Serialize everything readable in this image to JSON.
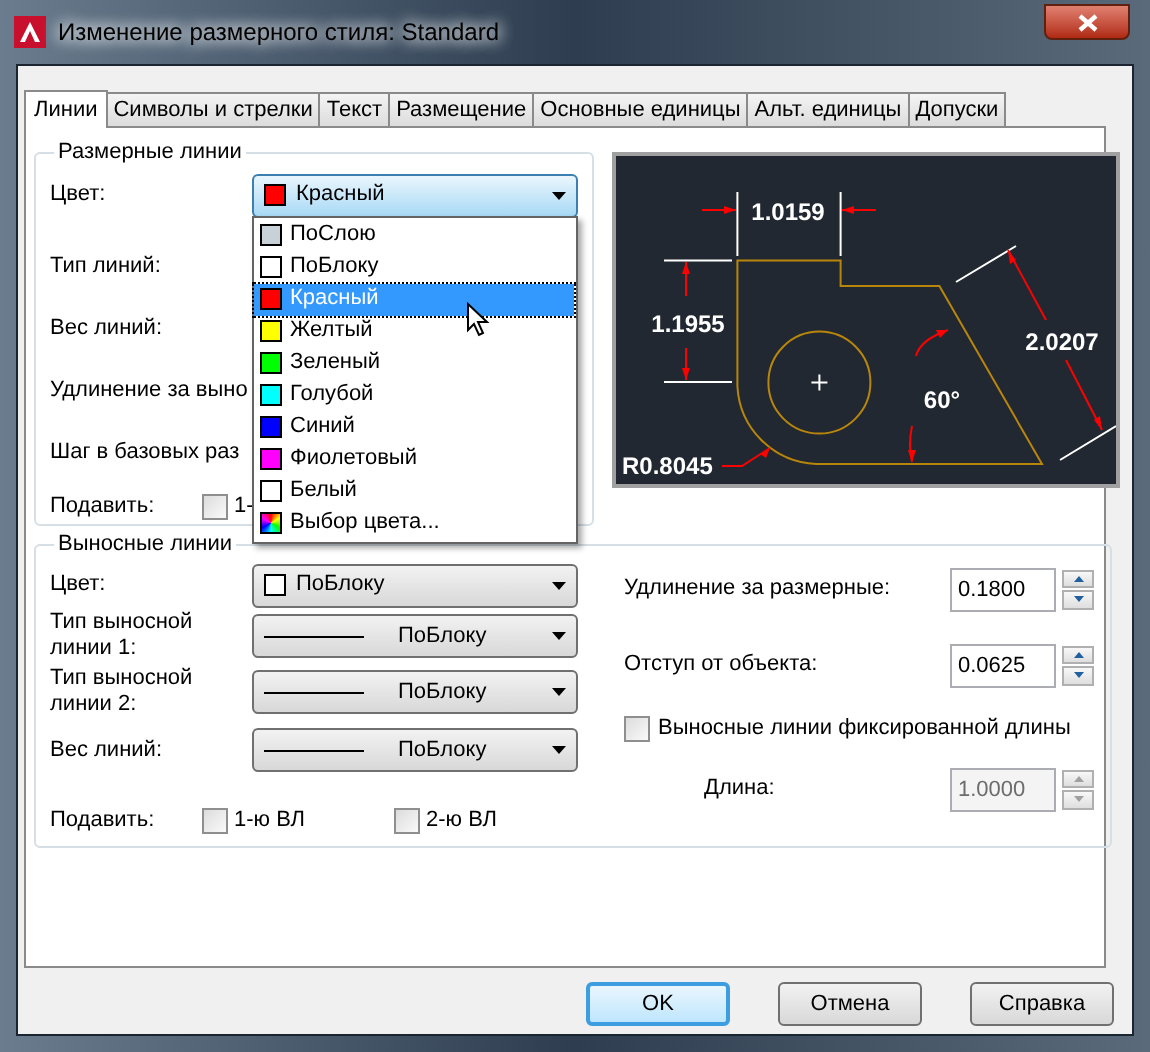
{
  "window": {
    "title": "Изменение размерного стиля: Standard"
  },
  "tabs": [
    {
      "label": "Линии",
      "selected": true
    },
    {
      "label": "Символы и стрелки",
      "selected": false
    },
    {
      "label": "Текст",
      "selected": false
    },
    {
      "label": "Размещение",
      "selected": false
    },
    {
      "label": "Основные единицы",
      "selected": false
    },
    {
      "label": "Альт. единицы",
      "selected": false
    },
    {
      "label": "Допуски",
      "selected": false
    }
  ],
  "dim_lines": {
    "title": "Размерные линии",
    "color_field": {
      "label": "Цвет:",
      "value": "Красный",
      "color": "#ff0000",
      "expanded": true,
      "options": [
        {
          "label": "ПоСлою",
          "color": "#c8d0d8",
          "selected": false,
          "kind": "swatch"
        },
        {
          "label": "ПоБлоку",
          "color": "#ffffff",
          "selected": false,
          "kind": "swatch"
        },
        {
          "label": "Красный",
          "color": "#ff0000",
          "selected": true,
          "kind": "swatch"
        },
        {
          "label": "Желтый",
          "color": "#ffff00",
          "selected": false,
          "kind": "swatch"
        },
        {
          "label": "Зеленый",
          "color": "#00ff00",
          "selected": false,
          "kind": "swatch"
        },
        {
          "label": "Голубой",
          "color": "#00ffff",
          "selected": false,
          "kind": "swatch"
        },
        {
          "label": "Синий",
          "color": "#0000ff",
          "selected": false,
          "kind": "swatch"
        },
        {
          "label": "Фиолетовый",
          "color": "#ff00ff",
          "selected": false,
          "kind": "swatch"
        },
        {
          "label": "Белый",
          "color": "#ffffff",
          "selected": false,
          "kind": "swatch"
        },
        {
          "label": "Выбор цвета...",
          "selected": false,
          "kind": "picker"
        }
      ]
    },
    "labels": [
      "Тип линий:",
      "Вес линий:",
      "Удлинение за выно",
      "Шаг в базовых раз"
    ],
    "suppress": {
      "label": "Подавить:",
      "checkbox": {
        "label": "1-",
        "checked": false
      }
    }
  },
  "preview": {
    "dims": [
      "1.0159",
      "1.1955",
      "2.0207",
      "60°",
      "R0.8045"
    ]
  },
  "ext_lines": {
    "title": "Выносные линии",
    "color_field": {
      "label": "Цвет:",
      "value": "ПоБлоку",
      "color": "#ffffff"
    },
    "linetypes": [
      {
        "label": "Тип выносной линии 1:",
        "value": "ПоБлоку"
      },
      {
        "label": "Тип выносной линии 2:",
        "value": "ПоБлоку"
      },
      {
        "label": "Вес линий:",
        "value": "ПоБлоку"
      }
    ],
    "suppress": {
      "label": "Подавить:",
      "checkboxes": [
        {
          "label": "1-ю ВЛ",
          "checked": false
        },
        {
          "label": "2-ю ВЛ",
          "checked": false
        }
      ]
    },
    "spins": [
      {
        "label": "Удлинение за размерные:",
        "value": "0.1800",
        "disabled": false
      },
      {
        "label": "Отступ от объекта:",
        "value": "0.0625",
        "disabled": false
      }
    ],
    "fixed": {
      "label": "Выносные линии фиксированной длины",
      "checked": false
    },
    "length": {
      "label": "Длина:",
      "value": "1.0000",
      "disabled": true
    }
  },
  "buttons": [
    {
      "label": "OK",
      "default": true
    },
    {
      "label": "Отмена",
      "default": false
    },
    {
      "label": "Справка",
      "default": false
    }
  ]
}
